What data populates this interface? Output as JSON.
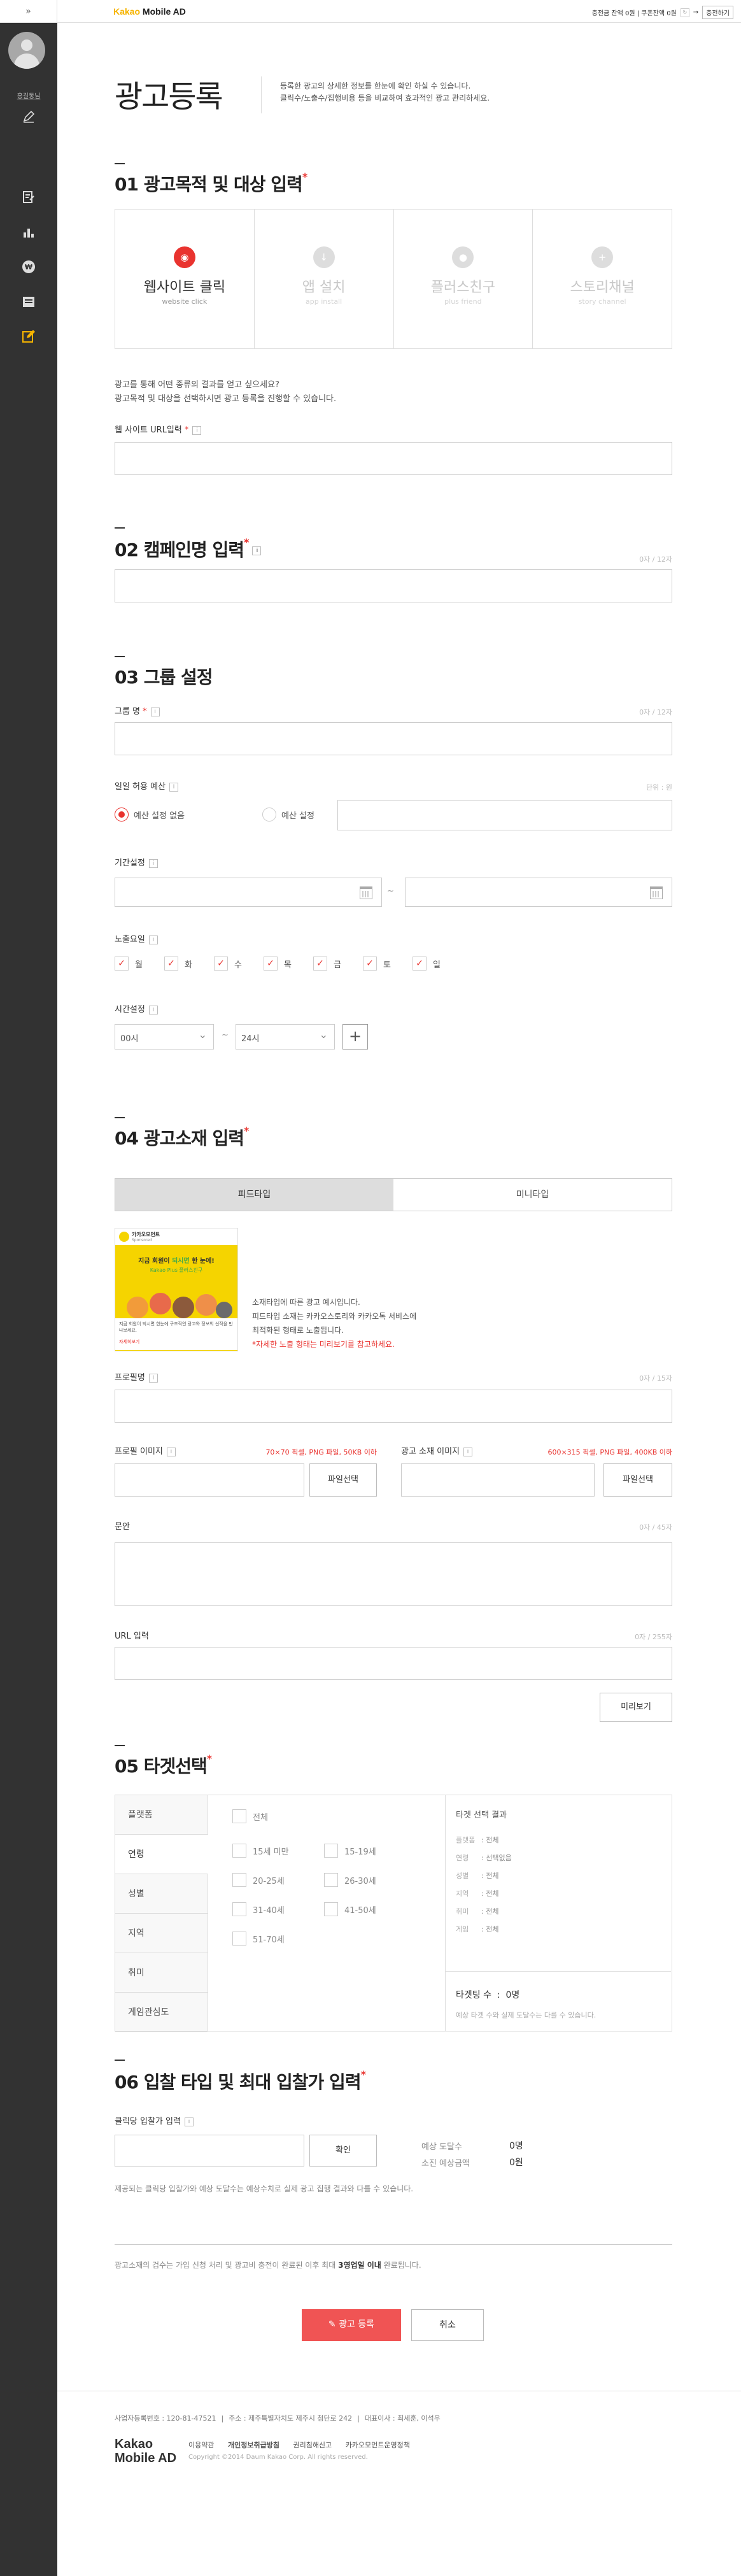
{
  "topbar": {
    "logo_kakao": "Kakao",
    "logo_rest": " Mobile AD",
    "notice": "충전금 잔액 0원 | 쿠폰잔액 0원",
    "charge_button": "충전하기"
  },
  "sidebar": {
    "user": "홍길동님",
    "icons": [
      "ad-register-icon",
      "stats-icon",
      "won-icon",
      "message-icon",
      "edit-icon"
    ]
  },
  "page": {
    "title": "광고등록",
    "desc1": "등록한 광고의 상세한 정보를 한눈에 확인 하실 수 있습니다.",
    "desc2": "클릭수/노출수/집행비용 등을 비교하여 효과적인 광고 관리하세요."
  },
  "s1": {
    "title": "01 광고목적 및 대상 입력",
    "objectives": [
      {
        "label": "웹사이트 클릭",
        "sub": "website click"
      },
      {
        "label": "앱 설치",
        "sub": "app install"
      },
      {
        "label": "플러스친구",
        "sub": "plus friend"
      },
      {
        "label": "스토리채널",
        "sub": "story channel"
      }
    ],
    "q1": "광고를 통해 어떤 종류의 결과를 얻고 싶으세요?",
    "q2": "광고목적 및 대상을 선택하시면 광고 등록을 진행할 수 있습니다.",
    "url_label": "웹 사이트 URL입력"
  },
  "s2": {
    "title": "02 캠페인명 입력",
    "count": "0자 / 12자"
  },
  "s3": {
    "title": "03 그룹 설정",
    "group_label": "그룹 명",
    "group_count": "0자 / 12자",
    "budget_label": "일일 허용 예산",
    "budget_unit": "단위 : 원",
    "radio_none": "예산 설정 없음",
    "radio_set": "예산 설정",
    "period_label": "기간설정",
    "period_sep": "~",
    "days_label": "노출요일",
    "days": [
      "월",
      "화",
      "수",
      "목",
      "금",
      "토",
      "일"
    ],
    "time_label": "시간설정",
    "time_from": "00시",
    "time_to": "24시",
    "time_sep": "~",
    "plus": "+"
  },
  "s4": {
    "title": "04 광고소재 입력",
    "tab_feed": "피드타입",
    "tab_mini": "미니타입",
    "ad_brand": "카카오모먼트",
    "ad_brand_sub": "Sponsored",
    "ad_headline_a": "지금 회원이 ",
    "ad_headline_b": "되시면",
    "ad_headline_c": " 한 눈에!",
    "ad_sub": "Kakao Plus 플러스친구",
    "ad_body": "지금 회원이 되시면 한눈에 구조적인 광고와 정보의 신작을 만나보세요.",
    "ad_more": "자세히보기",
    "note1": "소재타입에 따른 광고 예시입니다.",
    "note2": "피드타입 소재는 카카오스토리와 카카오톡 서비스에",
    "note3": "최적화된 형태로 노출됩니다.",
    "note4": "*자세한 노출 형태는 미리보기를 참고하세요.",
    "profile_label": "프로필명",
    "profile_count": "0자 / 15자",
    "profile_img_label": "프로필 이미지",
    "profile_img_hint": "70×70 픽셀, PNG 파일, 50KB 이하",
    "ad_img_label": "광고 소재 이미지",
    "ad_img_hint": "600×315 픽셀, PNG 파일, 400KB 이하",
    "file_button": "파일선택",
    "text_label": "문안",
    "text_count": "0자 / 45자",
    "url_label": "URL 입력",
    "url_count": "0자 / 255자",
    "preview_button": "미리보기"
  },
  "s5": {
    "title": "05 타겟선택",
    "tabs": [
      "플랫폼",
      "연령",
      "성별",
      "지역",
      "취미",
      "게임관심도"
    ],
    "ages": [
      "전체",
      "15세 미만",
      "15-19세",
      "20-25세",
      "26-30세",
      "31-40세",
      "41-50세",
      "51-70세"
    ],
    "result_title": "타겟 선택 결과",
    "result_rows": [
      {
        "k": "플랫폼",
        "v": "전체"
      },
      {
        "k": "연령",
        "v": "선택없음"
      },
      {
        "k": "성별",
        "v": "전체"
      },
      {
        "k": "지역",
        "v": "전체"
      },
      {
        "k": "취미",
        "v": "전체"
      },
      {
        "k": "게임",
        "v": "전체"
      }
    ],
    "target_count_label": "타겟팅 수",
    "target_count": "0명",
    "target_note": "예상 타겟 수와 실제 도달수는 다를 수 있습니다."
  },
  "s6": {
    "title": "06 입찰 타입 및 최대 입찰가 입력",
    "bid_label": "클릭당 입찰가 입력",
    "confirm_button": "확인",
    "reach_label": "예상 도달수",
    "reach_value": "0명",
    "cost_label": "소진 예상금액",
    "cost_value": "0원",
    "note": "제공되는 클릭당 입찰가와 예상 도달수는 예상수치로 실제 광고 집행 결과와 다를 수 있습니다."
  },
  "submit": {
    "note_a": "광고소재의 검수는 가입 신청 처리 및 광고비 충전이 완료된 이후 최대 ",
    "note_b": "3영업일 이내",
    "note_c": " 완료됩니다.",
    "register_button": "광고 등록",
    "cancel_button": "취소"
  },
  "footer": {
    "line": [
      "사업자등록번호 : 120-81-47521",
      "주소 : 제주특별자치도 제주시 첨단로 242",
      "대표이사 : 최세훈, 이석우"
    ],
    "logo1": "Kakao",
    "logo2": "Mobile AD",
    "links": [
      "이용약관",
      "개인정보취급방침",
      "권리침해신고",
      "카카오모먼트운영정책"
    ],
    "copyright": "Copyright ©2014 Daum Kakao Corp. All rights reserved."
  }
}
